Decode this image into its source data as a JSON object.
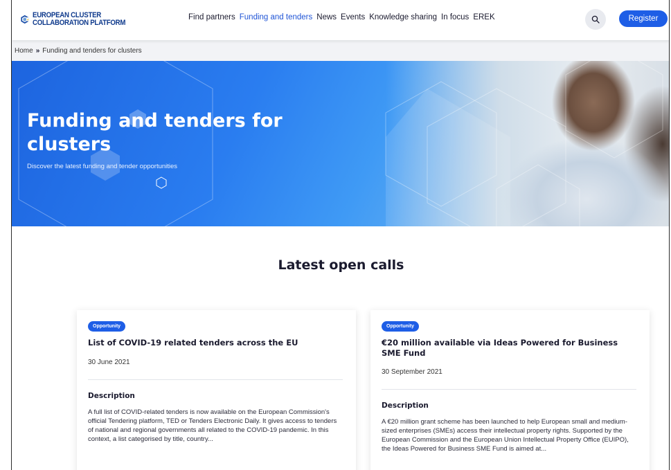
{
  "header": {
    "logo_line1": "EUROPEAN CLUSTER",
    "logo_line2": "COLLABORATION PLATFORM",
    "nav": [
      {
        "label": "Find partners",
        "active": false
      },
      {
        "label": "Funding and tenders",
        "active": true
      },
      {
        "label": "News",
        "active": false
      },
      {
        "label": "Events",
        "active": false
      },
      {
        "label": "Knowledge sharing",
        "active": false
      },
      {
        "label": "In focus",
        "active": false
      },
      {
        "label": "EREK",
        "active": false
      }
    ],
    "search_icon": "search-icon",
    "register_label": "Register"
  },
  "breadcrumb": {
    "home": "Home",
    "separator": "»",
    "current": "Funding and tenders for clusters"
  },
  "hero": {
    "title": "Funding and tenders for clusters",
    "subtitle": "Discover the latest funding and tender opportunities"
  },
  "section": {
    "title": "Latest open calls"
  },
  "cards": [
    {
      "badge": "Opportunity",
      "title": "List of COVID-19 related tenders across the EU",
      "date": "30 June 2021",
      "description_heading": "Description",
      "description": "A full list of COVID-related tenders is now available on the European Commission's official Tendering platform, TED or Tenders Electronic Daily. It gives access to tenders of national and regional governments all related to the COVID-19 pandemic. In this context, a list categorised by title, country..."
    },
    {
      "badge": "Opportunity",
      "title": "€20 million available via Ideas Powered for Business SME Fund",
      "date": "30 September 2021",
      "description_heading": "Description",
      "description": "A €20 million grant scheme has been launched to help European small and medium-sized enterprises (SMEs) access their intellectual property rights. Supported by the European Commission and the European Union Intellectual Property Office (EUIPO), the Ideas Powered for Business SME Fund is aimed at..."
    }
  ],
  "colors": {
    "brand_blue": "#1e5ee6",
    "nav_active": "#1f54d6",
    "logo_text": "#0f3a8c",
    "accent_yellow": "#f5c21b"
  }
}
